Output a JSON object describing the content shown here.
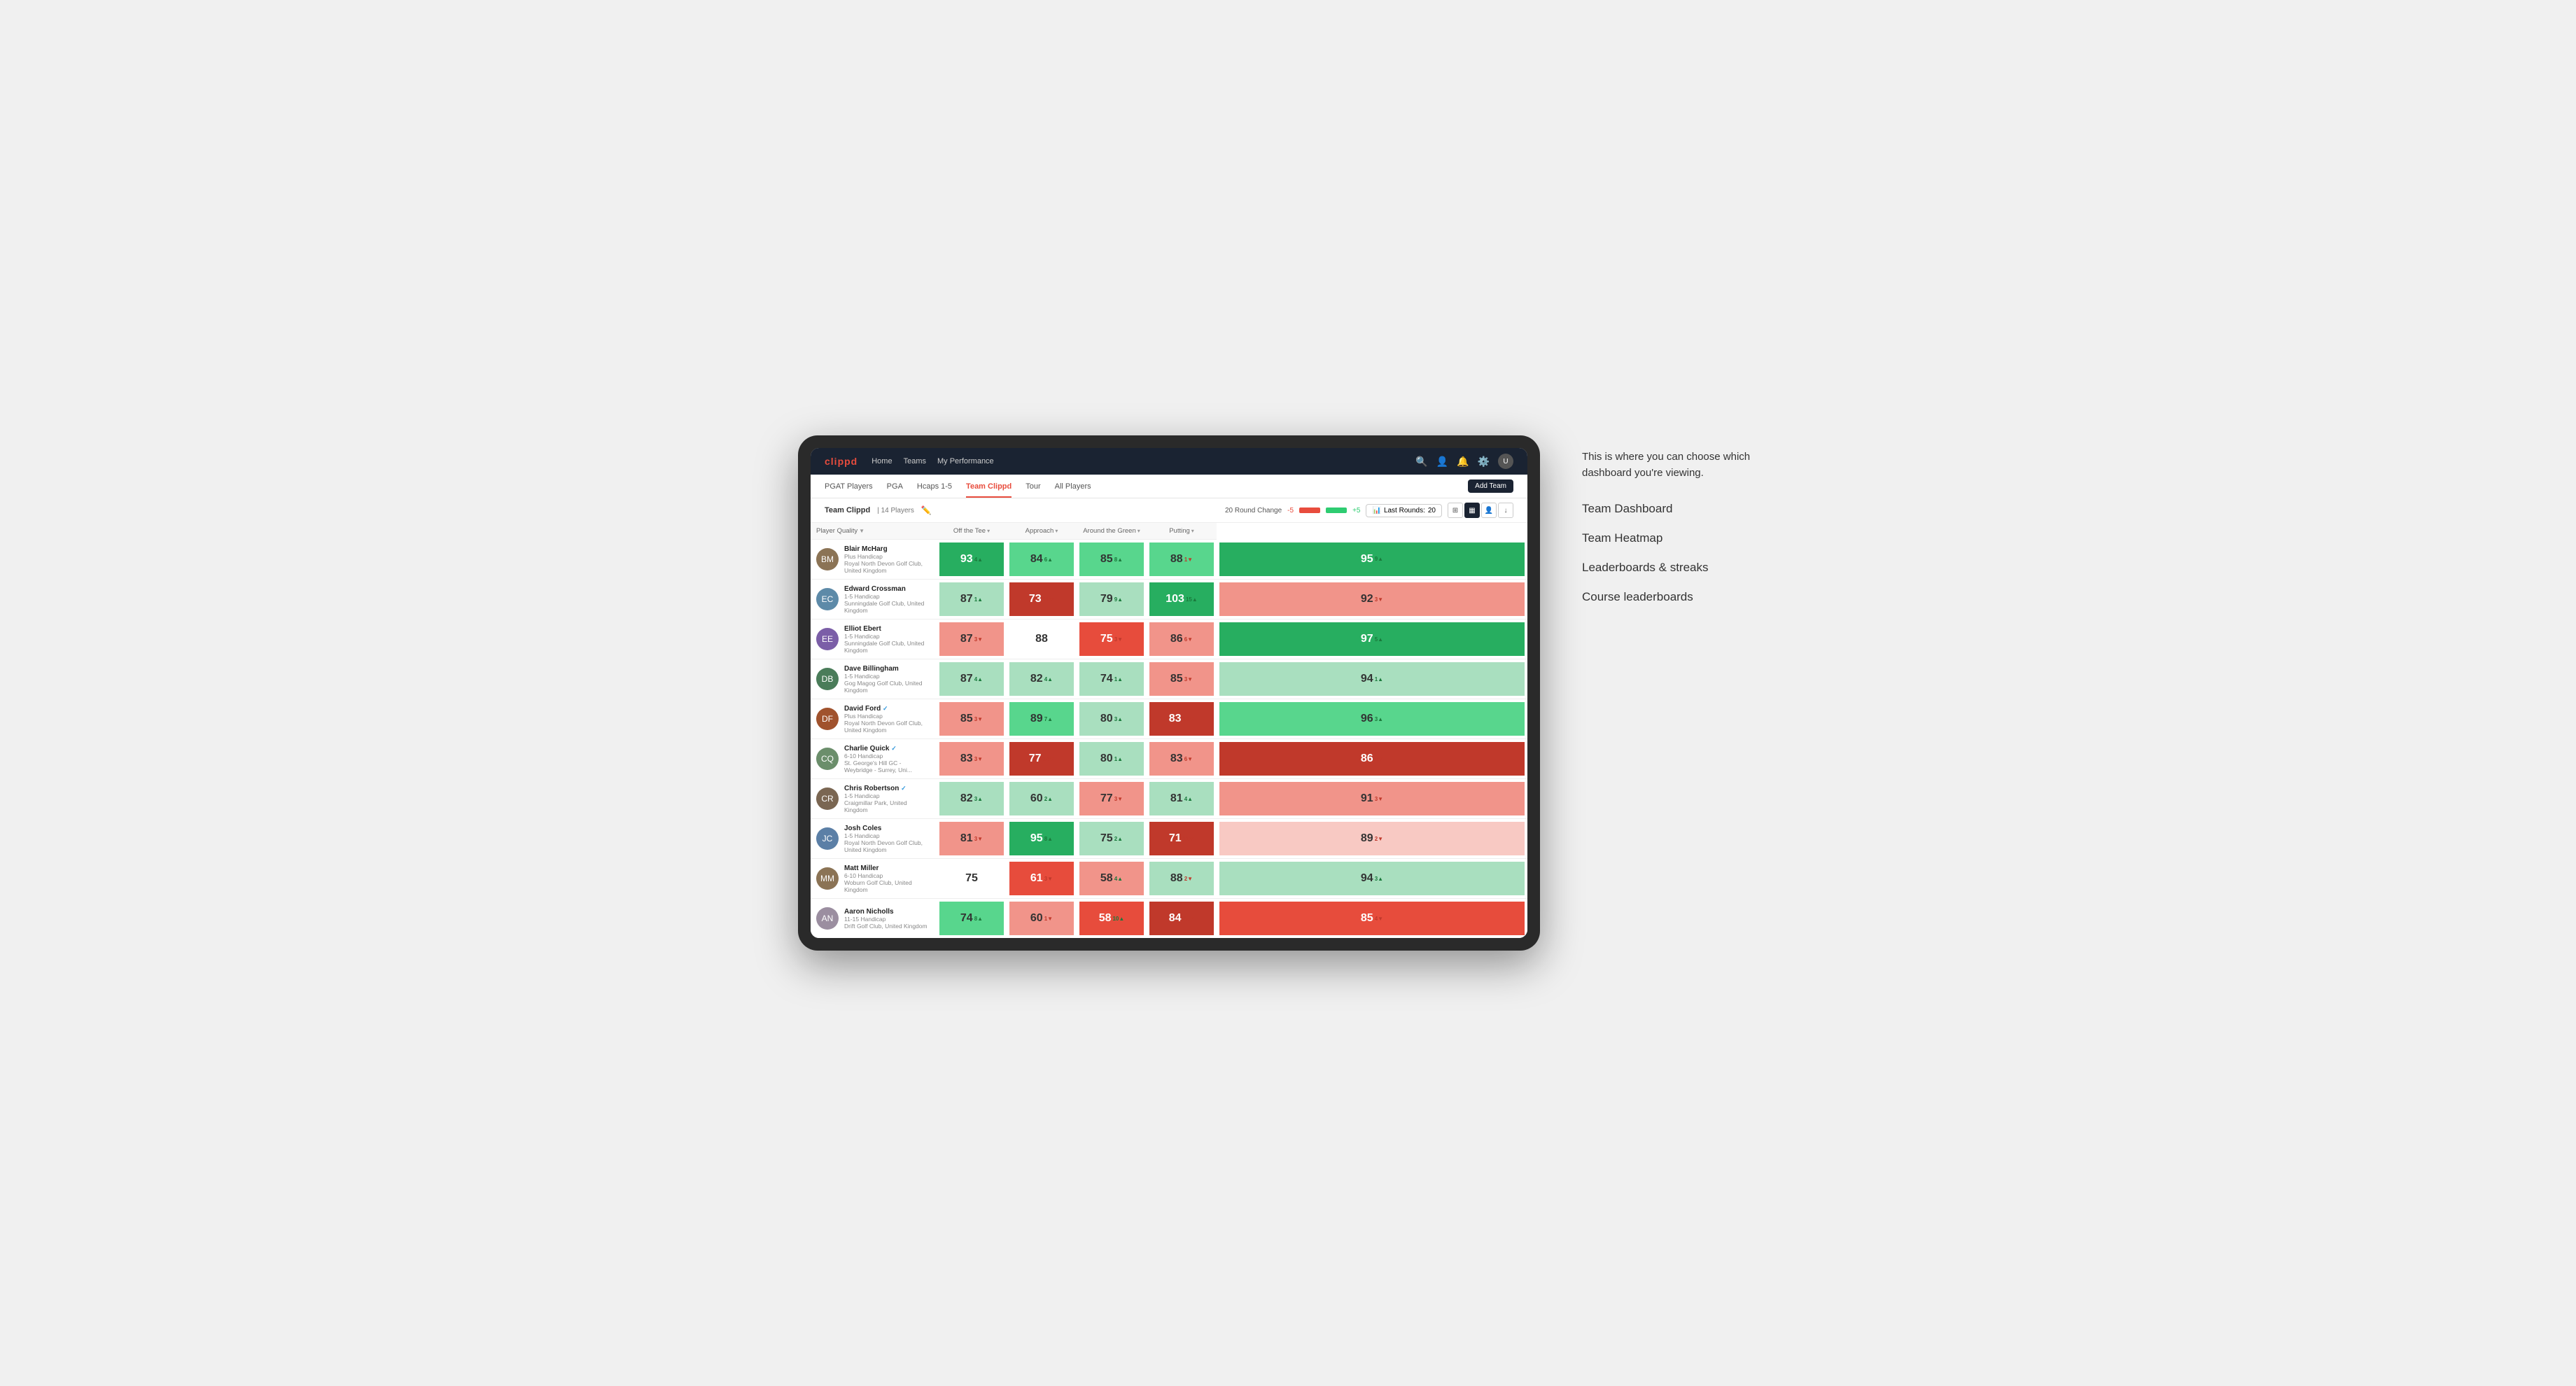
{
  "app": {
    "logo": "clippd",
    "nav": {
      "links": [
        "Home",
        "Teams",
        "My Performance"
      ]
    },
    "secondary_nav": {
      "links": [
        "PGAT Players",
        "PGA",
        "Hcaps 1-5",
        "Team Clippd",
        "Tour",
        "All Players"
      ],
      "active": "Team Clippd",
      "add_team": "Add Team"
    }
  },
  "team_bar": {
    "name": "Team Clippd",
    "separator": "|",
    "count": "14 Players",
    "round_change_label": "20 Round Change",
    "neg_val": "-5",
    "pos_val": "+5",
    "last_rounds_label": "Last Rounds:",
    "last_rounds_val": "20"
  },
  "table": {
    "columns": [
      {
        "id": "player",
        "label": "Player Quality",
        "arrow": "▼"
      },
      {
        "id": "off_tee",
        "label": "Off the Tee",
        "arrow": "▾"
      },
      {
        "id": "approach",
        "label": "Approach",
        "arrow": "▾"
      },
      {
        "id": "around_green",
        "label": "Around the Green",
        "arrow": "▾"
      },
      {
        "id": "putting",
        "label": "Putting",
        "arrow": "▾"
      }
    ],
    "players": [
      {
        "name": "Blair McHarg",
        "handicap": "Plus Handicap",
        "club": "Royal North Devon Golf Club, United Kingdom",
        "avatar_color": "#8B7355",
        "initials": "BM",
        "scores": [
          {
            "val": "93",
            "change": "4",
            "dir": "up",
            "bg": "bg-green-dark"
          },
          {
            "val": "84",
            "change": "6",
            "dir": "up",
            "bg": "bg-green-med"
          },
          {
            "val": "85",
            "change": "8",
            "dir": "up",
            "bg": "bg-green-med"
          },
          {
            "val": "88",
            "change": "1",
            "dir": "down",
            "bg": "bg-green-med"
          },
          {
            "val": "95",
            "change": "9",
            "dir": "up",
            "bg": "bg-green-dark"
          }
        ]
      },
      {
        "name": "Edward Crossman",
        "handicap": "1-5 Handicap",
        "club": "Sunningdale Golf Club, United Kingdom",
        "avatar_color": "#5D8AA8",
        "initials": "EC",
        "scores": [
          {
            "val": "87",
            "change": "1",
            "dir": "up",
            "bg": "bg-green-light"
          },
          {
            "val": "73",
            "change": "11",
            "dir": "down",
            "bg": "bg-red-dark"
          },
          {
            "val": "79",
            "change": "9",
            "dir": "up",
            "bg": "bg-green-light"
          },
          {
            "val": "103",
            "change": "15",
            "dir": "up",
            "bg": "bg-green-dark"
          },
          {
            "val": "92",
            "change": "3",
            "dir": "down",
            "bg": "bg-red-light"
          }
        ]
      },
      {
        "name": "Elliot Ebert",
        "handicap": "1-5 Handicap",
        "club": "Sunningdale Golf Club, United Kingdom",
        "avatar_color": "#7B5EA7",
        "initials": "EE",
        "scores": [
          {
            "val": "87",
            "change": "3",
            "dir": "down",
            "bg": "bg-red-light"
          },
          {
            "val": "88",
            "change": "",
            "dir": "none",
            "bg": "bg-white"
          },
          {
            "val": "75",
            "change": "3",
            "dir": "down",
            "bg": "bg-red-med"
          },
          {
            "val": "86",
            "change": "6",
            "dir": "down",
            "bg": "bg-red-light"
          },
          {
            "val": "97",
            "change": "5",
            "dir": "up",
            "bg": "bg-green-dark"
          }
        ]
      },
      {
        "name": "Dave Billingham",
        "handicap": "1-5 Handicap",
        "club": "Gog Magog Golf Club, United Kingdom",
        "avatar_color": "#4A7C59",
        "initials": "DB",
        "scores": [
          {
            "val": "87",
            "change": "4",
            "dir": "up",
            "bg": "bg-green-light"
          },
          {
            "val": "82",
            "change": "4",
            "dir": "up",
            "bg": "bg-green-light"
          },
          {
            "val": "74",
            "change": "1",
            "dir": "up",
            "bg": "bg-green-light"
          },
          {
            "val": "85",
            "change": "3",
            "dir": "down",
            "bg": "bg-red-light"
          },
          {
            "val": "94",
            "change": "1",
            "dir": "up",
            "bg": "bg-green-light"
          }
        ]
      },
      {
        "name": "David Ford",
        "handicap": "Plus Handicap",
        "club": "Royal North Devon Golf Club, United Kingdom",
        "avatar_color": "#A0522D",
        "initials": "DF",
        "verified": true,
        "scores": [
          {
            "val": "85",
            "change": "3",
            "dir": "down",
            "bg": "bg-red-light"
          },
          {
            "val": "89",
            "change": "7",
            "dir": "up",
            "bg": "bg-green-med"
          },
          {
            "val": "80",
            "change": "3",
            "dir": "up",
            "bg": "bg-green-light"
          },
          {
            "val": "83",
            "change": "10",
            "dir": "down",
            "bg": "bg-red-dark"
          },
          {
            "val": "96",
            "change": "3",
            "dir": "up",
            "bg": "bg-green-med"
          }
        ]
      },
      {
        "name": "Charlie Quick",
        "handicap": "6-10 Handicap",
        "club": "St. George's Hill GC - Weybridge - Surrey, Uni...",
        "avatar_color": "#6B8E6B",
        "initials": "CQ",
        "verified": true,
        "scores": [
          {
            "val": "83",
            "change": "3",
            "dir": "down",
            "bg": "bg-red-light"
          },
          {
            "val": "77",
            "change": "14",
            "dir": "down",
            "bg": "bg-red-dark"
          },
          {
            "val": "80",
            "change": "1",
            "dir": "up",
            "bg": "bg-green-light"
          },
          {
            "val": "83",
            "change": "6",
            "dir": "down",
            "bg": "bg-red-light"
          },
          {
            "val": "86",
            "change": "8",
            "dir": "down",
            "bg": "bg-red-dark"
          }
        ]
      },
      {
        "name": "Chris Robertson",
        "handicap": "1-5 Handicap",
        "club": "Craigmillar Park, United Kingdom",
        "avatar_color": "#7A6652",
        "initials": "CR",
        "verified": true,
        "scores": [
          {
            "val": "82",
            "change": "3",
            "dir": "up",
            "bg": "bg-green-light"
          },
          {
            "val": "60",
            "change": "2",
            "dir": "up",
            "bg": "bg-green-light"
          },
          {
            "val": "77",
            "change": "3",
            "dir": "down",
            "bg": "bg-red-light"
          },
          {
            "val": "81",
            "change": "4",
            "dir": "up",
            "bg": "bg-green-light"
          },
          {
            "val": "91",
            "change": "3",
            "dir": "down",
            "bg": "bg-red-light"
          }
        ]
      },
      {
        "name": "Josh Coles",
        "handicap": "1-5 Handicap",
        "club": "Royal North Devon Golf Club, United Kingdom",
        "avatar_color": "#5B7FA6",
        "initials": "JC",
        "scores": [
          {
            "val": "81",
            "change": "3",
            "dir": "down",
            "bg": "bg-red-light"
          },
          {
            "val": "95",
            "change": "8",
            "dir": "up",
            "bg": "bg-green-dark"
          },
          {
            "val": "75",
            "change": "2",
            "dir": "up",
            "bg": "bg-green-light"
          },
          {
            "val": "71",
            "change": "11",
            "dir": "down",
            "bg": "bg-red-dark"
          },
          {
            "val": "89",
            "change": "2",
            "dir": "down",
            "bg": "bg-orange-light"
          }
        ]
      },
      {
        "name": "Matt Miller",
        "handicap": "6-10 Handicap",
        "club": "Woburn Golf Club, United Kingdom",
        "avatar_color": "#8B7355",
        "initials": "MM",
        "scores": [
          {
            "val": "75",
            "change": "",
            "dir": "none",
            "bg": "bg-white"
          },
          {
            "val": "61",
            "change": "3",
            "dir": "down",
            "bg": "bg-red-med"
          },
          {
            "val": "58",
            "change": "4",
            "dir": "up",
            "bg": "bg-red-light"
          },
          {
            "val": "88",
            "change": "2",
            "dir": "down",
            "bg": "bg-green-light"
          },
          {
            "val": "94",
            "change": "3",
            "dir": "up",
            "bg": "bg-green-light"
          }
        ]
      },
      {
        "name": "Aaron Nicholls",
        "handicap": "11-15 Handicap",
        "club": "Drift Golf Club, United Kingdom",
        "avatar_color": "#9B8EA0",
        "initials": "AN",
        "scores": [
          {
            "val": "74",
            "change": "8",
            "dir": "up",
            "bg": "bg-green-med"
          },
          {
            "val": "60",
            "change": "1",
            "dir": "down",
            "bg": "bg-red-light"
          },
          {
            "val": "58",
            "change": "10",
            "dir": "up",
            "bg": "bg-red-med"
          },
          {
            "val": "84",
            "change": "21",
            "dir": "down",
            "bg": "bg-red-dark"
          },
          {
            "val": "85",
            "change": "4",
            "dir": "down",
            "bg": "bg-red-med"
          }
        ]
      }
    ]
  },
  "annotations": {
    "intro_text": "This is where you can choose which dashboard you're viewing.",
    "options": [
      "Team Dashboard",
      "Team Heatmap",
      "Leaderboards & streaks",
      "Course leaderboards"
    ]
  }
}
